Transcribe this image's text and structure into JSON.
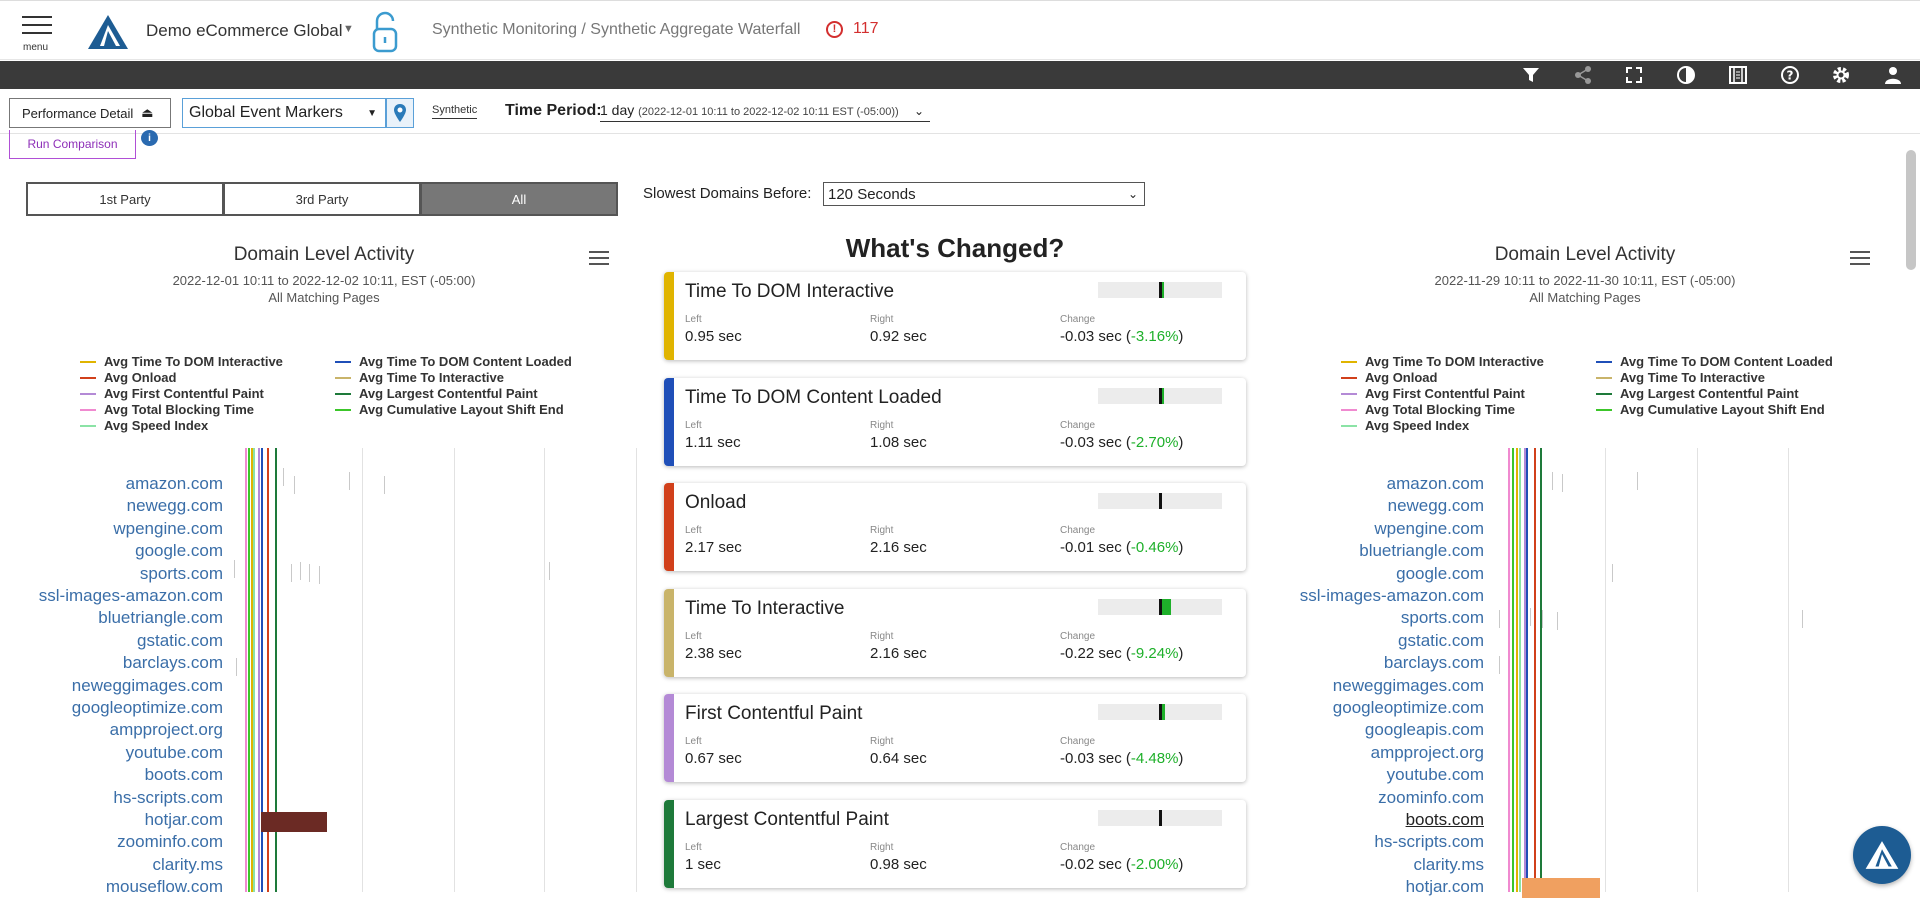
{
  "header": {
    "menu_label": "menu",
    "org_name": "Demo eCommerce Global",
    "breadcrumb": "Synthetic Monitoring / Synthetic Aggregate Waterfall",
    "alert_count": "117"
  },
  "toolbar": {
    "icons": [
      "filter-icon",
      "share-icon",
      "fullscreen-icon",
      "contrast-icon",
      "film-icon",
      "help-icon",
      "settings-icon",
      "user-icon"
    ]
  },
  "filters": {
    "perf_detail_label": "Performance Detail",
    "event_markers_value": "Global Event Markers",
    "synthetic_label": "Synthetic",
    "time_period_label": "Time Period:",
    "time_period_value": "1 day",
    "time_period_range": "(2022-12-01 10:11 to 2022-12-02 10:11 EST (-05:00))",
    "run_comparison_label": "Run Comparison",
    "info_label": "i"
  },
  "party": {
    "tabs": [
      "1st Party",
      "3rd Party",
      "All"
    ],
    "selected": "All"
  },
  "slowest": {
    "label": "Slowest Domains Before:",
    "value": "120 Seconds"
  },
  "legend": [
    {
      "label": "Avg Time To DOM Interactive",
      "color": "#e0b400"
    },
    {
      "label": "Avg Time To DOM Content Loaded",
      "color": "#1f4fb8"
    },
    {
      "label": "Avg Onload",
      "color": "#d1401b"
    },
    {
      "label": "Avg Time To Interactive",
      "color": "#c9b46a"
    },
    {
      "label": "Avg First Contentful Paint",
      "color": "#b48ad6"
    },
    {
      "label": "Avg Largest Contentful Paint",
      "color": "#1e7a3a"
    },
    {
      "label": "Avg Total Blocking Time",
      "color": "#f08ad0"
    },
    {
      "label": "Avg Cumulative Layout Shift End",
      "color": "#3cc62a"
    },
    {
      "label": "Avg Speed Index",
      "color": "#8be3a6"
    }
  ],
  "left_panel": {
    "title": "Domain Level Activity",
    "range": "2022-12-01 10:11 to 2022-12-02 10:11, EST (-05:00)",
    "pages": "All Matching Pages",
    "domains": [
      "amazon.com",
      "newegg.com",
      "wpengine.com",
      "google.com",
      "sports.com",
      "ssl-images-amazon.com",
      "bluetriangle.com",
      "gstatic.com",
      "barclays.com",
      "neweggimages.com",
      "googleoptimize.com",
      "ampproject.org",
      "youtube.com",
      "boots.com",
      "hs-scripts.com",
      "hotjar.com",
      "zoominfo.com",
      "clarity.ms",
      "mouseflow.com"
    ]
  },
  "right_panel": {
    "title": "Domain Level Activity",
    "range": "2022-11-29 10:11 to 2022-11-30 10:11, EST (-05:00)",
    "pages": "All Matching Pages",
    "domains": [
      "amazon.com",
      "newegg.com",
      "wpengine.com",
      "bluetriangle.com",
      "google.com",
      "ssl-images-amazon.com",
      "sports.com",
      "gstatic.com",
      "barclays.com",
      "neweggimages.com",
      "googleoptimize.com",
      "googleapis.com",
      "ampproject.org",
      "youtube.com",
      "zoominfo.com",
      "boots.com",
      "hs-scripts.com",
      "clarity.ms",
      "hotjar.com"
    ]
  },
  "whats_changed": {
    "title": "What's Changed?",
    "col_labels": {
      "left": "Left",
      "right": "Right",
      "change": "Change"
    },
    "cards": [
      {
        "title": "Time To DOM Interactive",
        "color": "#e0b400",
        "left": "0.95 sec",
        "right": "0.92 sec",
        "change": "-0.03 sec",
        "pct": "-3.16%",
        "delta": 0.03
      },
      {
        "title": "Time To DOM Content Loaded",
        "color": "#1f4fb8",
        "left": "1.11 sec",
        "right": "1.08 sec",
        "change": "-0.03 sec",
        "pct": "-2.70%",
        "delta": 0.03
      },
      {
        "title": "Onload",
        "color": "#d1401b",
        "left": "2.17 sec",
        "right": "2.16 sec",
        "change": "-0.01 sec",
        "pct": "-0.46%",
        "delta": 0.0
      },
      {
        "title": "Time To Interactive",
        "color": "#c9b46a",
        "left": "2.38 sec",
        "right": "2.16 sec",
        "change": "-0.22 sec",
        "pct": "-9.24%",
        "delta": 0.09
      },
      {
        "title": "First Contentful Paint",
        "color": "#b48ad6",
        "left": "0.67 sec",
        "right": "0.64 sec",
        "change": "-0.03 sec",
        "pct": "-4.48%",
        "delta": 0.04
      },
      {
        "title": "Largest Contentful Paint",
        "color": "#1e7a3a",
        "left": "1 sec",
        "right": "0.98 sec",
        "change": "-0.02 sec",
        "pct": "-2.00%",
        "delta": 0.0
      }
    ]
  }
}
